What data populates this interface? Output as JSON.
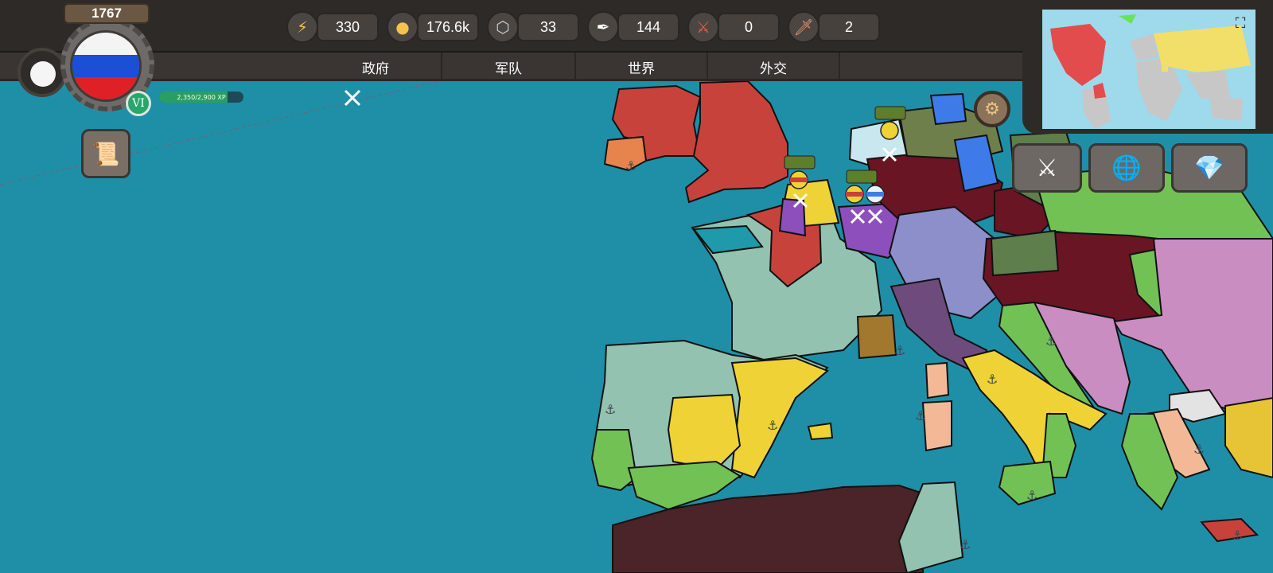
{
  "player": {
    "year": "1767",
    "rank": "VI",
    "xp_text": "2,350/2,900 XP",
    "xp_fraction": 0.81,
    "flag": "russia",
    "country_colors": {
      "white": "#f4f4f4",
      "blue": "#1a4fd6",
      "red": "#e02027"
    }
  },
  "resources": [
    {
      "icon": "lightning-icon",
      "glyph": "⚡",
      "value": "330"
    },
    {
      "icon": "gold-coins-icon",
      "glyph": "●",
      "value": "176.6k"
    },
    {
      "icon": "manpower-icon",
      "glyph": "⬡",
      "value": "33"
    },
    {
      "icon": "quill-icon",
      "glyph": "✒",
      "value": "144"
    },
    {
      "icon": "crossed-swords-icon",
      "glyph": "⚔",
      "value": "0"
    },
    {
      "icon": "sword-icon",
      "glyph": "🗡",
      "value": "2"
    }
  ],
  "tabs": [
    "政府",
    "军队",
    "世界",
    "外交"
  ],
  "actions": [
    {
      "name": "war-button",
      "icon": "sword-icon",
      "glyph": "⚔"
    },
    {
      "name": "world-button",
      "icon": "globe-icon",
      "glyph": "🌐"
    },
    {
      "name": "premium-button",
      "icon": "diamond-icon",
      "glyph": "💎"
    }
  ],
  "colors": {
    "ocean": "#1f8fa8",
    "ui_dark": "#2e2a27",
    "britain": "#c8423c",
    "france_mint": "#93c2b0",
    "spain_yellow": "#efd336",
    "austria_lavender": "#8c8fca",
    "prussia_maroon": "#6a1524",
    "ottoman_pink": "#c98dc2",
    "russia_green": "#72c155",
    "north_africa": "#4a2428"
  }
}
